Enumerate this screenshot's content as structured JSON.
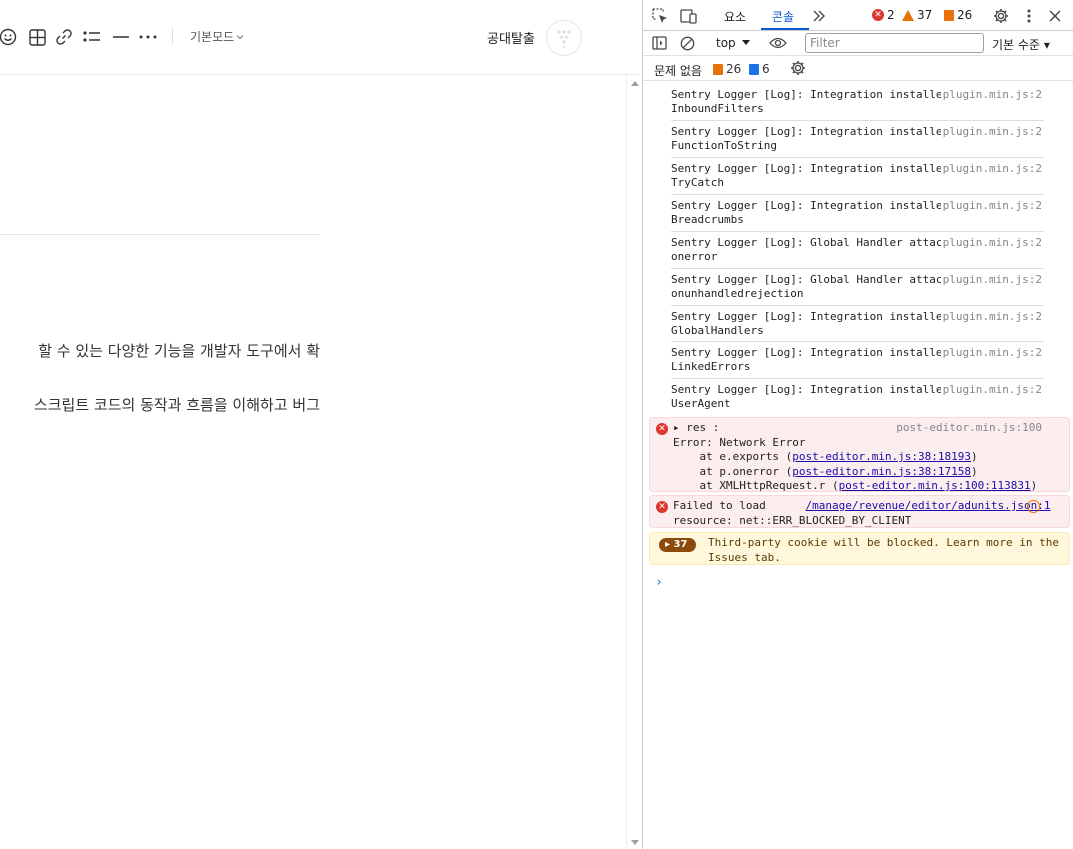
{
  "editor": {
    "toolbar": {
      "mode_label": "기본모드",
      "publish_label": "공대탈출"
    },
    "lines": [
      "할 수 있는 다양한 기능을 개발자 도구에서 확",
      "스크립트 코드의 동작과 흐름을 이해하고 버그"
    ]
  },
  "devtools": {
    "tabs": {
      "elements": "요소",
      "console": "콘솔"
    },
    "counts": {
      "errors": "2",
      "warnings": "37",
      "issues": "26"
    },
    "context": "top",
    "filter_placeholder": "Filter",
    "level": "기본 수준",
    "issues_label": "문제 없음",
    "issues_orange": "26",
    "issues_blue": "6",
    "logs": [
      {
        "text": "Sentry Logger [Log]: Integration installed:\nInboundFilters",
        "source": "plugin.min.js:2"
      },
      {
        "text": "Sentry Logger [Log]: Integration installed:\nFunctionToString",
        "source": "plugin.min.js:2"
      },
      {
        "text": "Sentry Logger [Log]: Integration installed:\nTryCatch",
        "source": "plugin.min.js:2"
      },
      {
        "text": "Sentry Logger [Log]: Integration installed:\nBreadcrumbs",
        "source": "plugin.min.js:2"
      },
      {
        "text": "Sentry Logger [Log]: Global Handler attached:\nonerror",
        "source": "plugin.min.js:2"
      },
      {
        "text": "Sentry Logger [Log]: Global Handler attached:\nonunhandledrejection",
        "source": "plugin.min.js:2"
      },
      {
        "text": "Sentry Logger [Log]: Integration installed:\nGlobalHandlers",
        "source": "plugin.min.js:2"
      },
      {
        "text": "Sentry Logger [Log]: Integration installed:\nLinkedErrors",
        "source": "plugin.min.js:2"
      },
      {
        "text": "Sentry Logger [Log]: Integration installed:\nUserAgent",
        "source": "plugin.min.js:2"
      }
    ],
    "error1": {
      "head": "▸ res :",
      "source": "post-editor.min.js:100",
      "line2": "Error: Network Error",
      "at1_prefix": "    at e.exports (",
      "at1_link": "post-editor.min.js:38:18193",
      "at2_prefix": "    at p.onerror (",
      "at2_link": "post-editor.min.js:38:17158",
      "at3_prefix": "    at XMLHttpRequest.r (",
      "at3_link": "post-editor.min.js:100:113831",
      "close": ")"
    },
    "error2": {
      "line1": "Failed to load",
      "link": "/manage/revenue/editor/adunits.json:1",
      "line2": "resource: net::ERR_BLOCKED_BY_CLIENT"
    },
    "warning": {
      "count": "37",
      "text": "Third-party cookie will be blocked. Learn more in the\nIssues tab."
    },
    "prompt": "›"
  }
}
